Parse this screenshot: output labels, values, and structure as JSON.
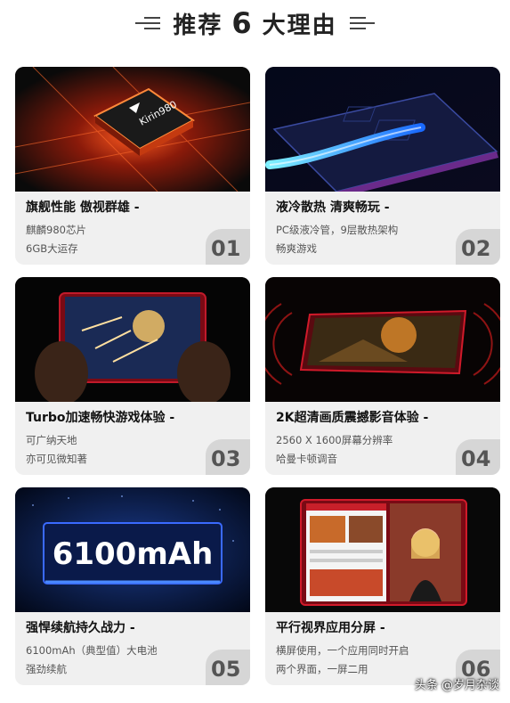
{
  "header": {
    "prefix": "推荐",
    "number": "6",
    "suffix": "大理由"
  },
  "cards": [
    {
      "title": "旗舰性能 傲视群雄 -",
      "line1": "麒麟980芯片",
      "line2": "6GB大运存",
      "badge": "01",
      "chip_text": "Kirin980"
    },
    {
      "title": "液冷散热 清爽畅玩 -",
      "line1": "PC级液冷管，9层散热架构",
      "line2": "畅爽游戏",
      "badge": "02"
    },
    {
      "title": "Turbo加速畅快游戏体验 -",
      "line1": "可广纳天地",
      "line2": "亦可见微知著",
      "badge": "03"
    },
    {
      "title": "2K超清画质震撼影音体验 -",
      "line1": "2560 X 1600屏幕分辨率",
      "line2": "哈曼卡顿调音",
      "badge": "04"
    },
    {
      "title": "强悍续航持久战力 -",
      "line1": "6100mAh（典型值）大电池",
      "line2": "强劲续航",
      "badge": "05",
      "battery_text": "6100mAh"
    },
    {
      "title": "平行视界应用分屏 -",
      "line1": "横屏使用，一个应用同时开启",
      "line2": "两个界面，一屏二用",
      "badge": "06"
    }
  ],
  "watermark": "头条 @岁月杂谈"
}
